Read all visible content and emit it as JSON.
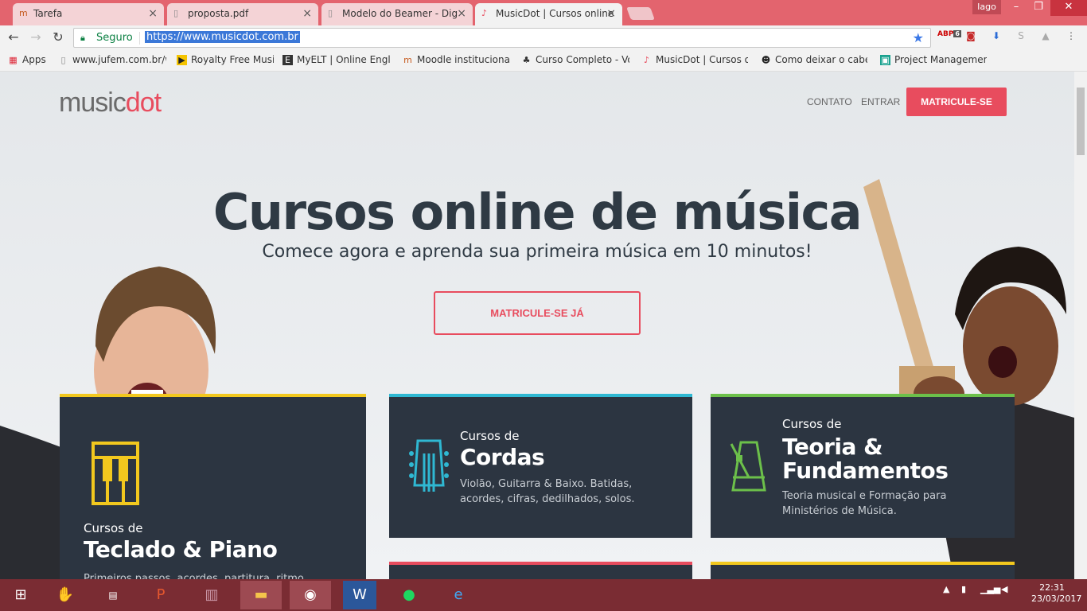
{
  "browser": {
    "tabs": [
      {
        "title": "Tarefa",
        "icon": "moodle-icon"
      },
      {
        "title": "proposta.pdf",
        "icon": "document-icon"
      },
      {
        "title": "Modelo do Beamer - Dig",
        "icon": "document-icon"
      },
      {
        "title": "MusicDot | Cursos online",
        "icon": "musicdot-icon"
      }
    ],
    "user": "Iago",
    "security_label": "Seguro",
    "url": "https://www.musicdot.com.br",
    "bookmarks": [
      {
        "label": "Apps"
      },
      {
        "label": "www.jufem.com.br/wp"
      },
      {
        "label": "Royalty Free Music"
      },
      {
        "label": "MyELT | Online Englis"
      },
      {
        "label": "Moodle institucional d"
      },
      {
        "label": "Curso Completo - Voc"
      },
      {
        "label": "MusicDot | Cursos onl"
      },
      {
        "label": "Como deixar o cabelo"
      },
      {
        "label": "Project Management"
      }
    ],
    "ext_badge": "6"
  },
  "site": {
    "logo_part1": "music",
    "logo_part2": "dot",
    "nav": {
      "contact": "CONTATO",
      "login": "ENTRAR",
      "enroll": "MATRICULE-SE"
    },
    "hero": {
      "title": "Cursos online de música",
      "subtitle": "Comece agora e aprenda sua primeira música em 10 minutos!",
      "cta": "MATRICULE-SE JÁ"
    },
    "cards": [
      {
        "small": "Cursos de",
        "big": "Teclado & Piano",
        "desc": "Primeiros passos, acordes, partitura, ritmo",
        "accent": "#f2c81e"
      },
      {
        "small": "Cursos de",
        "big": "Cordas",
        "desc": "Violão, Guitarra & Baixo. Batidas, acordes, cifras, dedilhados, solos.",
        "accent": "#2fb8d2"
      },
      {
        "small": "Cursos de",
        "big": "Teoria & Fundamentos",
        "desc": "Teoria musical e Formação para Ministérios de Música.",
        "accent": "#6cc04a"
      }
    ],
    "brand_color": "#e84c5e"
  },
  "taskbar": {
    "time": "22:31",
    "date": "23/03/2017"
  }
}
